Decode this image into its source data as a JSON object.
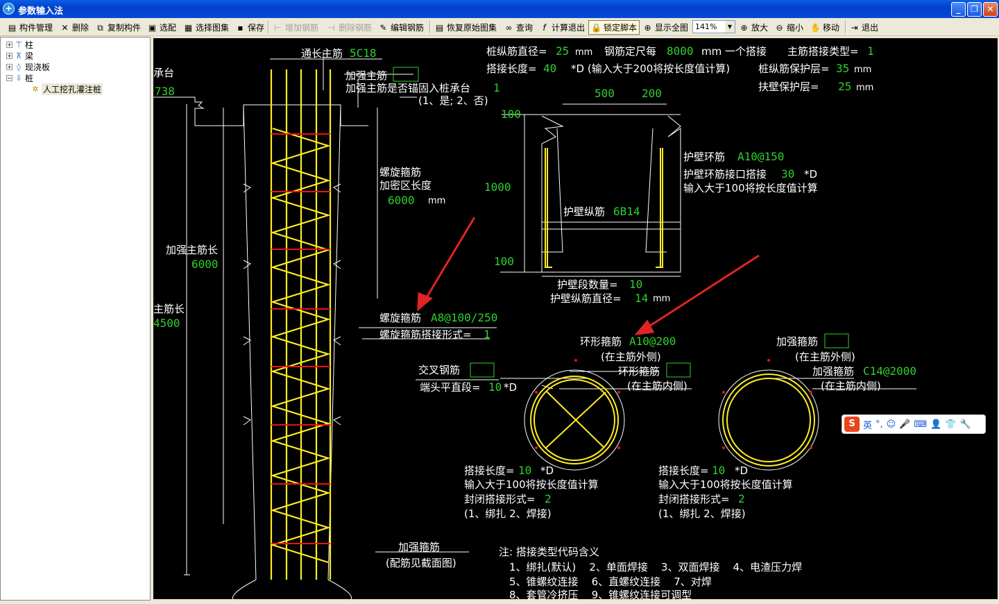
{
  "window": {
    "title": "参数输入法"
  },
  "toolbar": {
    "items": [
      {
        "label": "构件管理",
        "icon": "component-icon"
      },
      {
        "label": "删除",
        "icon": "delete-x-icon"
      },
      {
        "label": "复制构件",
        "icon": "copy-icon"
      },
      {
        "label": "选配",
        "icon": "select-match-icon"
      },
      {
        "label": "选择图集",
        "icon": "atlas-icon"
      },
      {
        "label": "保存",
        "icon": "save-icon"
      },
      {
        "label": "增加钢筋",
        "icon": "add-rebar-icon",
        "disabled": true
      },
      {
        "label": "删除钢筋",
        "icon": "delete-rebar-icon",
        "disabled": true
      },
      {
        "label": "编辑钢筋",
        "icon": "edit-rebar-icon"
      },
      {
        "label": "恢复原始图集",
        "icon": "restore-icon"
      },
      {
        "label": "查询",
        "icon": "binoculars-icon"
      },
      {
        "label": "计算退出",
        "icon": "fx-icon"
      },
      {
        "label": "锁定脚本",
        "icon": "lock-icon"
      },
      {
        "label": "显示全图",
        "icon": "fit-view-icon"
      },
      {
        "label": "放大",
        "icon": "zoom-in-icon"
      },
      {
        "label": "缩小",
        "icon": "zoom-out-icon"
      },
      {
        "label": "移动",
        "icon": "move-hand-icon"
      },
      {
        "label": "退出",
        "icon": "exit-icon"
      }
    ],
    "zoom": "141%"
  },
  "tree": {
    "items": [
      "柱",
      "梁",
      "现浇板",
      "桩",
      "人工挖孔灌注桩"
    ]
  },
  "drawing": {
    "top_params": {
      "l1": "桩纵筋直径=",
      "v_dia": "25",
      "u_mm1": "mm",
      "l2": "钢筋定尺每",
      "v_len": "8000",
      "l3": "mm 一个搭接",
      "l4": "主筋搭接类型=",
      "v_type": "1",
      "l5": "搭接长度=",
      "v_lap": "40",
      "l6": "*D (输入大于200将按长度值计算)",
      "l7": "桩纵筋保护层=",
      "v_cover": "35",
      "u_mm2": "mm",
      "l8": "扶壁保护层=",
      "v_wall": "25",
      "u_mm3": "mm"
    },
    "pile": {
      "cap_label": "承台",
      "cap_val": "738",
      "main_label": "通长主筋",
      "main_val": "5C18",
      "add_main": "加强主筋",
      "anchor": "加强主筋是否锚固入桩承台",
      "anchor_val": "1",
      "anchor_opt": "(1、是; 2、否)",
      "spiral1": "螺旋箍筋",
      "spiral2": "加密区长度",
      "dense_val": "6000",
      "dense_unit": "mm",
      "add_len": "加强主筋长",
      "add_len_val": "6000",
      "main_len": "主筋长",
      "main_len_val": "4500",
      "spiral_label": "螺旋箍筋",
      "spiral_val": "A8@100/250",
      "spiral_lap": "螺旋箍筋搭接形式=",
      "spiral_lap_val": "1",
      "stirrup": "加强箍筋",
      "stirrup_note": "(配筋见截面图)"
    },
    "wall": {
      "d500": "500",
      "d200": "200",
      "d100a": "100",
      "d1000": "1000",
      "d100b": "100",
      "ring": "护壁环筋",
      "ring_val": "A10@150",
      "ring_lap": "护壁环筋接口搭接",
      "ring_lap_val": "30",
      "ring_lap_unit": "*D",
      "ring_note": "输入大于100将按长度值计算",
      "long": "护壁纵筋",
      "long_val": "6B14",
      "seg": "护壁段数量=",
      "seg_val": "10",
      "dia": "护壁纵筋直径=",
      "dia_val": "14",
      "dia_unit": "mm"
    },
    "section1": {
      "hoop": "环形箍筋",
      "hoop_val": "A10@200",
      "outer": "(在主筋外侧)",
      "cross": "交叉钢筋",
      "end": "端头平直段=",
      "end_val": "10",
      "end_unit": "*D",
      "hoop2": "环形箍筋",
      "inner": "(在主筋内侧)",
      "lap": "搭接长度=",
      "lap_val": "10",
      "lap_unit": "*D",
      "note": "输入大于100将按长度值计算",
      "close": "封闭搭接形式=",
      "close_val": "2",
      "opts": "(1、绑扎  2、焊接)"
    },
    "section2": {
      "hoop": "加强箍筋",
      "outer": "(在主筋外侧)",
      "add": "加强箍筋",
      "add_val": "C14@2000",
      "inner": "(在主筋内侧)",
      "lap": "搭接长度=",
      "lap_val": "10",
      "lap_unit": "*D",
      "note": "输入大于100将按长度值计算",
      "close": "封闭搭接形式=",
      "close_val": "2",
      "opts": "(1、绑扎  2、焊接)"
    },
    "notes": {
      "title": "注: 搭接类型代码含义",
      "r1": "1、绑扎(默认)    2、单面焊接    3、双面焊接    4、电渣压力焊",
      "r2": "5、锥螺纹连接    6、直螺纹连接    7、对焊",
      "r3": "8、套管冷挤压    9、锥螺纹连接可调型"
    }
  },
  "ime": {
    "lang": "英"
  },
  "colors": {
    "rebar": "#ffee22",
    "hoop": "#ee1111",
    "value": "#2fd02f",
    "canvas": "#000000",
    "titlebar": "#0848d8"
  }
}
